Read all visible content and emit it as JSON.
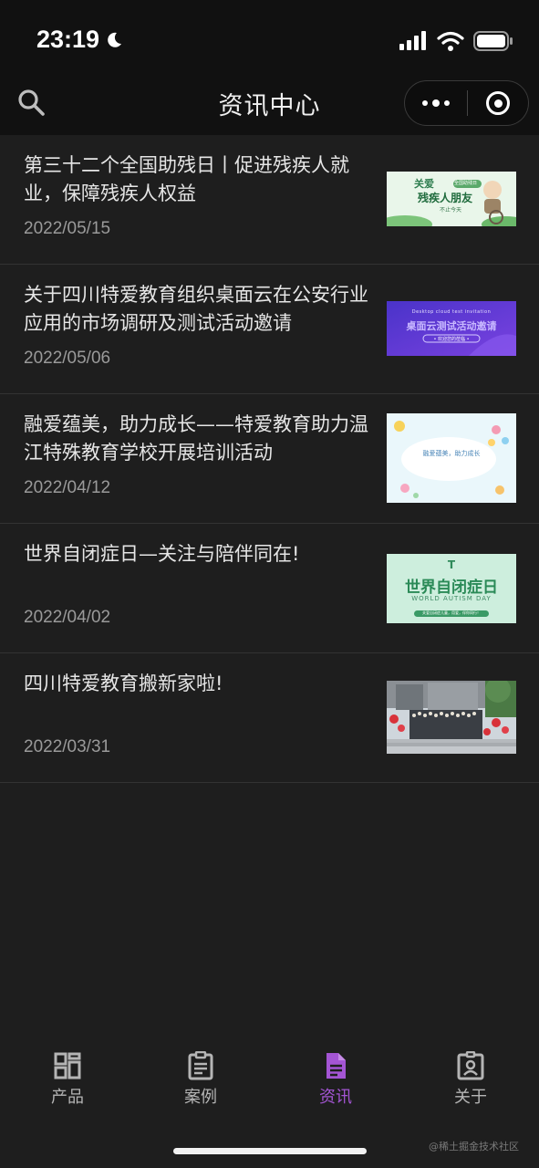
{
  "status": {
    "time": "23:19"
  },
  "nav": {
    "title": "资讯中心"
  },
  "news": [
    {
      "title": "第三十二个全国助残日丨促进残疾人就业，保障残疾人权益",
      "date": "2022/05/15",
      "thumb": {
        "line1": "关爱",
        "line2": "残疾人朋友",
        "line3": "不止今天",
        "badge": "全国助残日"
      }
    },
    {
      "title": "关于四川特爱教育组织桌面云在公安行业应用的市场调研及测试活动邀请",
      "date": "2022/05/06",
      "thumb": {
        "line1": "Desktop cloud test invitation",
        "line2": "桌面云测试活动邀请",
        "line3": "• 欢迎您的莅临 •"
      }
    },
    {
      "title": "融爱蕴美，助力成长——特爱教育助力温江特殊教育学校开展培训活动",
      "date": "2022/04/12",
      "thumb": {
        "line1": "融爱蕴美，助力成长"
      }
    },
    {
      "title": "世界自闭症日—关注与陪伴同在!",
      "date": "2022/04/02",
      "thumb": {
        "line1": "世界自闭症日",
        "line2": "WORLD AUTISM DAY",
        "line3": "关爱自闭症儿童，用爱，伴你同行！"
      }
    },
    {
      "title": "四川特爱教育搬新家啦!",
      "date": "2022/03/31",
      "thumb": {}
    }
  ],
  "tabs": [
    {
      "label": "产品",
      "icon": "grid-icon",
      "active": false
    },
    {
      "label": "案例",
      "icon": "clipboard-icon",
      "active": false
    },
    {
      "label": "资讯",
      "icon": "document-icon",
      "active": true
    },
    {
      "label": "关于",
      "icon": "badge-icon",
      "active": false
    }
  ],
  "watermark": "@稀土掘金技术社区",
  "colors": {
    "accent": "#a455d4",
    "background": "#1e1e1e",
    "header": "#111111"
  }
}
